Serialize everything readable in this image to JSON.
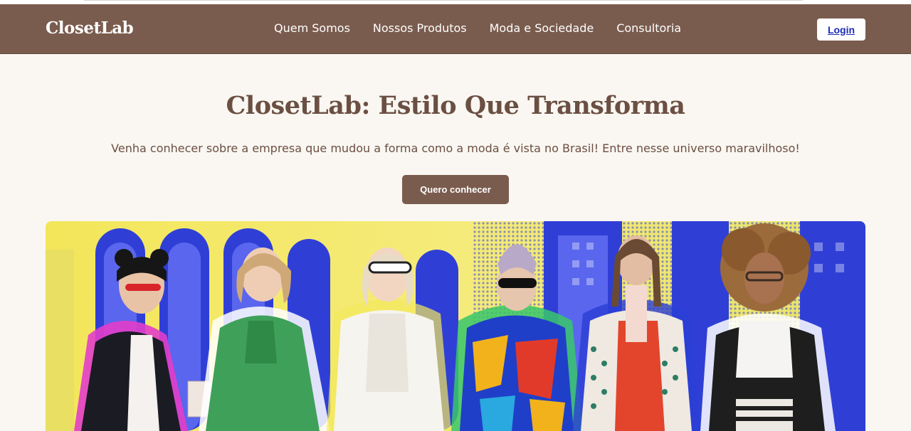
{
  "header": {
    "brand": "ClosetLab",
    "nav": [
      "Quem Somos",
      "Nossos Produtos",
      "Moda e Sociedade",
      "Consultoria"
    ],
    "login_label": "Login"
  },
  "hero": {
    "title": "ClosetLab: Estilo Que Transforma",
    "subtitle": "Venha conhecer sobre a empresa que mudou a forma como a moda é vista no Brasil! Entre nesse universo maravilhoso!",
    "cta_label": "Quero conhecer"
  },
  "colors": {
    "header_bg": "#7a5c4e",
    "page_bg": "#faf7f2",
    "title_color": "#6b4f42",
    "button_bg": "#7a5c4e"
  }
}
